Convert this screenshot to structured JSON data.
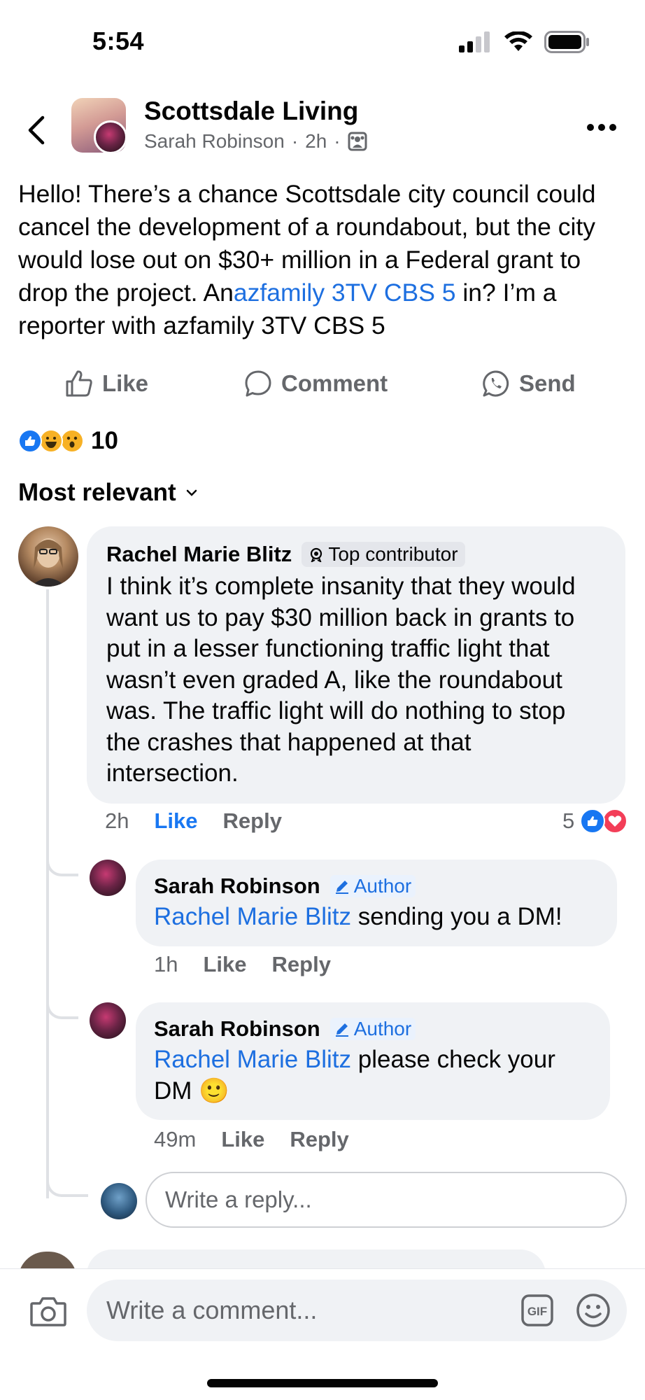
{
  "status_bar": {
    "time": "5:54"
  },
  "header": {
    "group_name": "Scottsdale Living",
    "author": "Sarah Robinson",
    "separator": "·",
    "time": "2h"
  },
  "post": {
    "text_1": "Hello! There’s a chance Scottsdale city council could cancel the development of a roundabout, but the city would lose out on $30+ million in a Federal grant to drop the project. An",
    "link": "azfamily 3TV CBS 5",
    "text_2": " in? I’m a reporter with azfamily 3TV CBS 5"
  },
  "actions": {
    "like": "Like",
    "comment": "Comment",
    "send": "Send"
  },
  "reactions": {
    "count": "10"
  },
  "sort": {
    "label": "Most relevant"
  },
  "comments": [
    {
      "name": "Rachel Marie Blitz",
      "badge": "Top contributor",
      "text": "I think it’s complete insanity that they would want us to pay $30 million back in grants to put in a lesser functioning traffic light that wasn’t even graded A, like the roundabout was.  The traffic light will do nothing to stop the crashes that happened at that intersection.",
      "time": "2h",
      "like": "Like",
      "reply": "Reply",
      "reaction_count": "5"
    }
  ],
  "replies": [
    {
      "name": "Sarah Robinson",
      "badge": "Author",
      "mention": "Rachel Marie Blitz",
      "text": " sending you a DM!",
      "time": "1h",
      "like": "Like",
      "reply": "Reply"
    },
    {
      "name": "Sarah Robinson",
      "badge": "Author",
      "mention": "Rachel Marie Blitz",
      "text": " please check your DM 🙂",
      "time": "49m",
      "like": "Like",
      "reply": "Reply"
    }
  ],
  "reply_input": {
    "placeholder": "Write a reply..."
  },
  "comment_input": {
    "placeholder": "Write a comment..."
  },
  "icons": {
    "back": "chevron-left-icon",
    "more": "more-horizontal-icon",
    "audience": "group-audience-icon",
    "camera": "camera-icon",
    "gif": "gif-icon",
    "emoji": "emoji-icon"
  },
  "colors": {
    "link": "#1d6fe0",
    "like_blue": "#1877f2",
    "love_red": "#f33e58",
    "secondary_text": "#65676b",
    "bubble_bg": "#f0f2f5"
  }
}
